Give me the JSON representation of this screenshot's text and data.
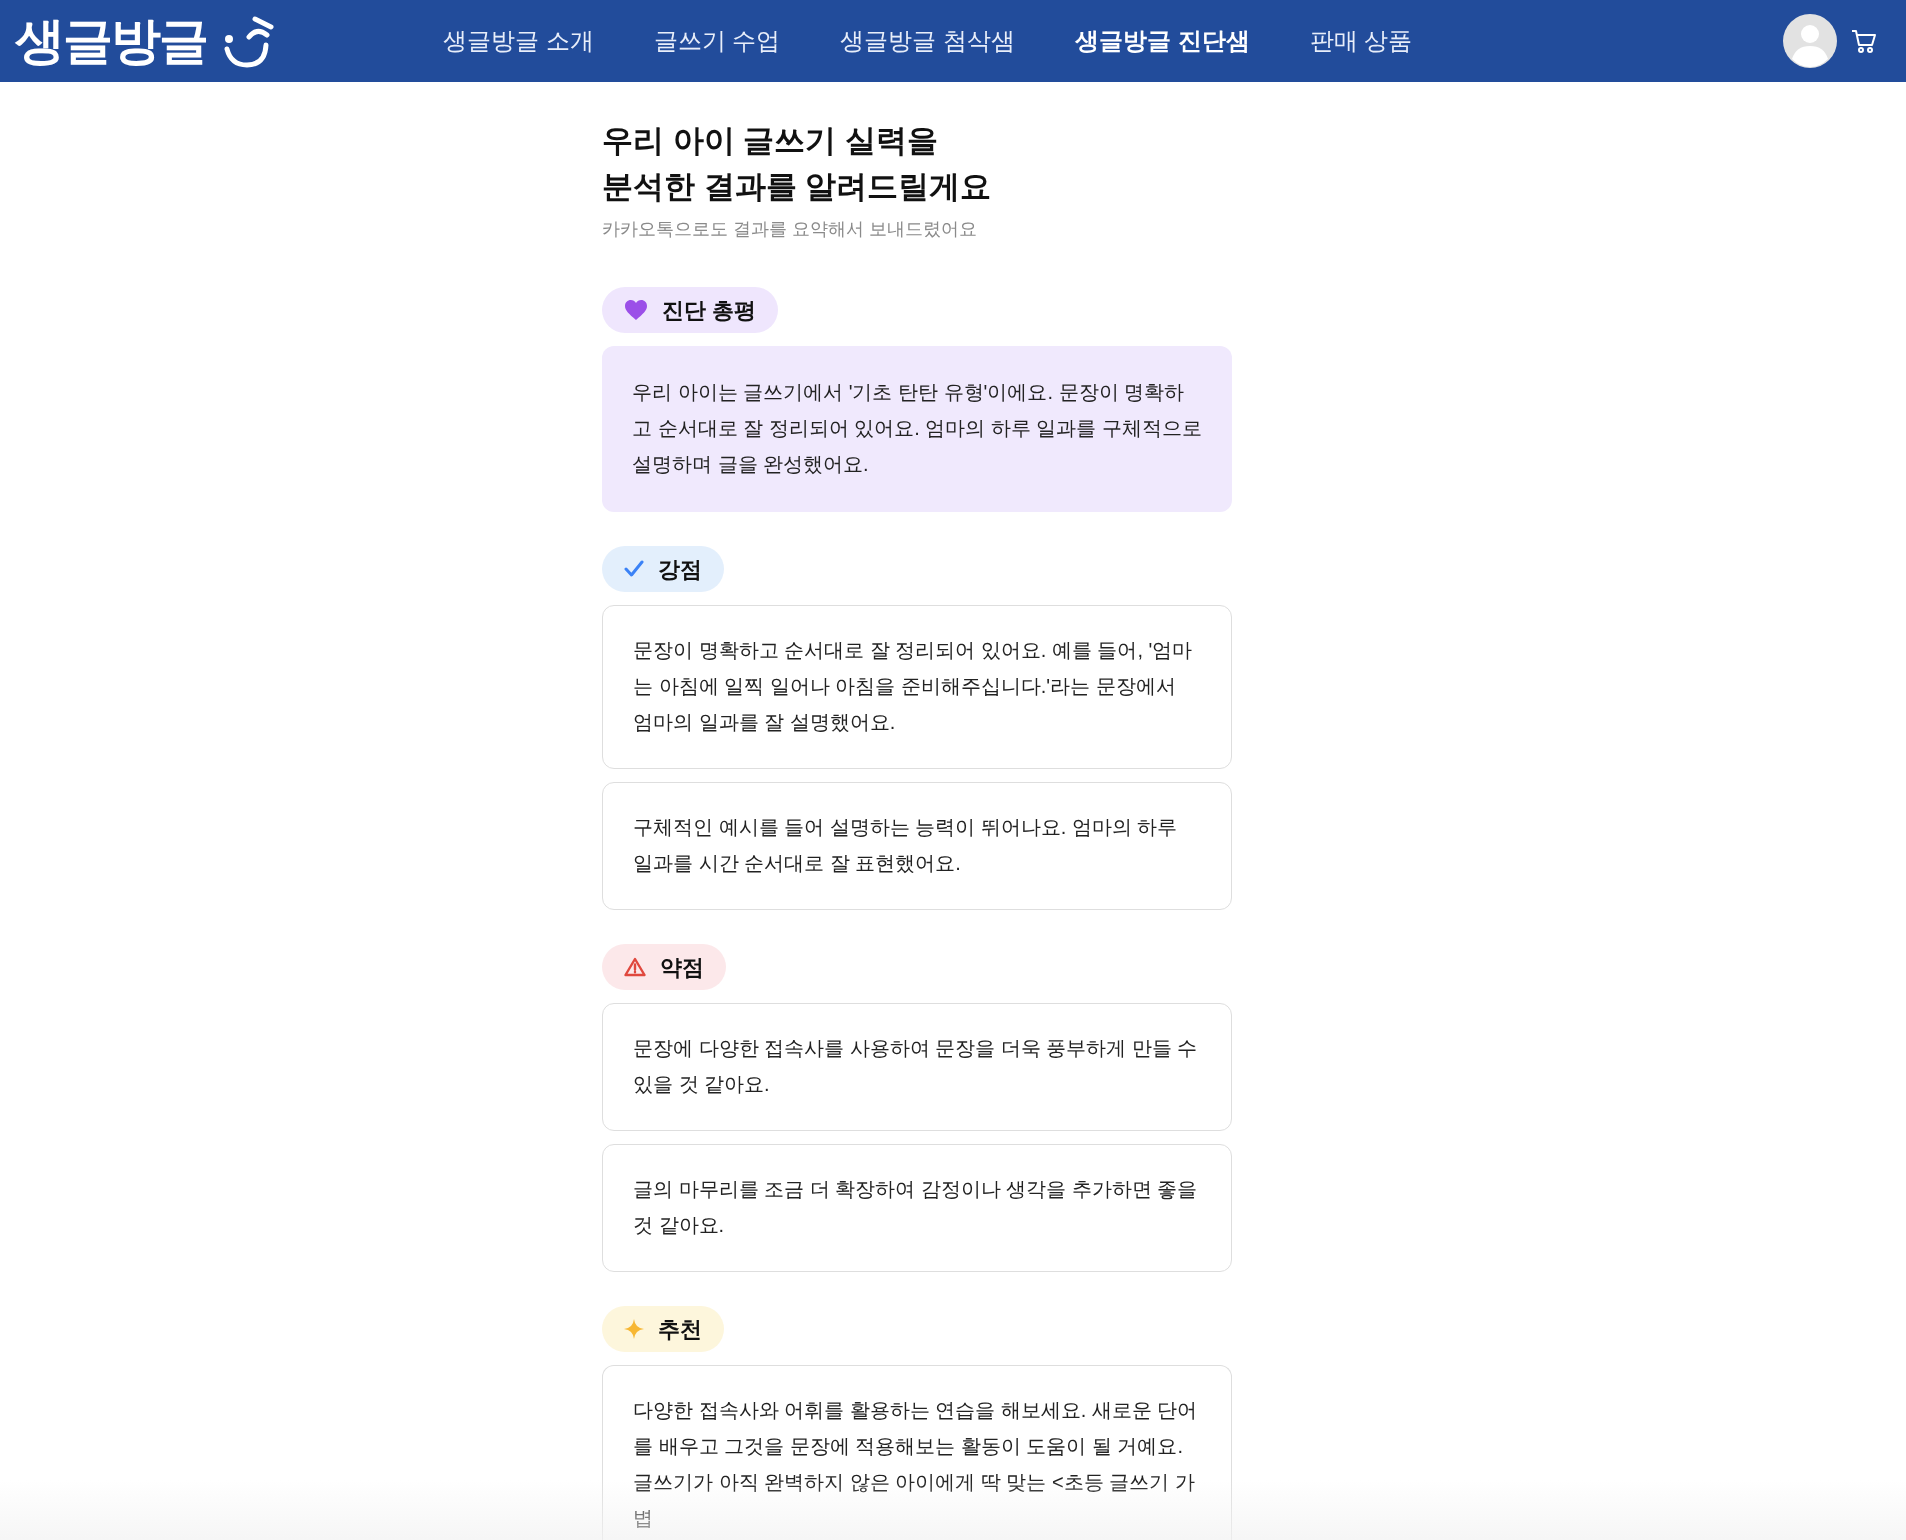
{
  "header": {
    "logo": "생글방글",
    "nav": [
      {
        "label": "생글방글 소개",
        "selected": false
      },
      {
        "label": "글쓰기 수업",
        "selected": false
      },
      {
        "label": "생글방글 첨삭샘",
        "selected": false
      },
      {
        "label": "생글방글 진단샘",
        "selected": true
      },
      {
        "label": "판매 상품",
        "selected": false
      }
    ]
  },
  "title_lines": [
    "우리 아이 글쓰기 실력을",
    "분석한 결과를 알려드릴게요"
  ],
  "subtitle": "카카오톡으로도 결과를 요약해서 보내드렸어요",
  "sections": [
    {
      "kind": "summary",
      "label": "진단 총평",
      "items": [
        "우리 아이는 글쓰기에서 '기초 탄탄 유형'이에요. 문장이 명확하고 순서대로 잘 정리되어 있어요. 엄마의 하루 일과를 구체적으로 설명하며 글을 완성했어요."
      ]
    },
    {
      "kind": "strength",
      "label": "강점",
      "items": [
        "문장이 명확하고 순서대로 잘 정리되어 있어요. 예를 들어, '엄마는 아침에 일찍 일어나 아침을 준비해주십니다.'라는 문장에서 엄마의 일과를 잘 설명했어요.",
        "구체적인 예시를 들어 설명하는 능력이 뛰어나요. 엄마의 하루 일과를 시간 순서대로 잘 표현했어요."
      ]
    },
    {
      "kind": "weakness",
      "label": "약점",
      "items": [
        "문장에 다양한 접속사를 사용하여 문장을 더욱 풍부하게 만들 수 있을 것 같아요.",
        "글의 마무리를 조금 더 확장하여 감정이나 생각을 추가하면 좋을 것 같아요."
      ]
    },
    {
      "kind": "recommend",
      "label": "추천",
      "items": [
        "다양한 접속사와 어휘를 활용하는 연습을 해보세요. 새로운 단어를 배우고 그것을 문장에 적용해보는 활동이 도움이 될 거예요. 글쓰기가 아직 완벽하지 않은 아이에게 딱 맞는 <초등 글쓰기 가볍"
      ]
    }
  ]
}
